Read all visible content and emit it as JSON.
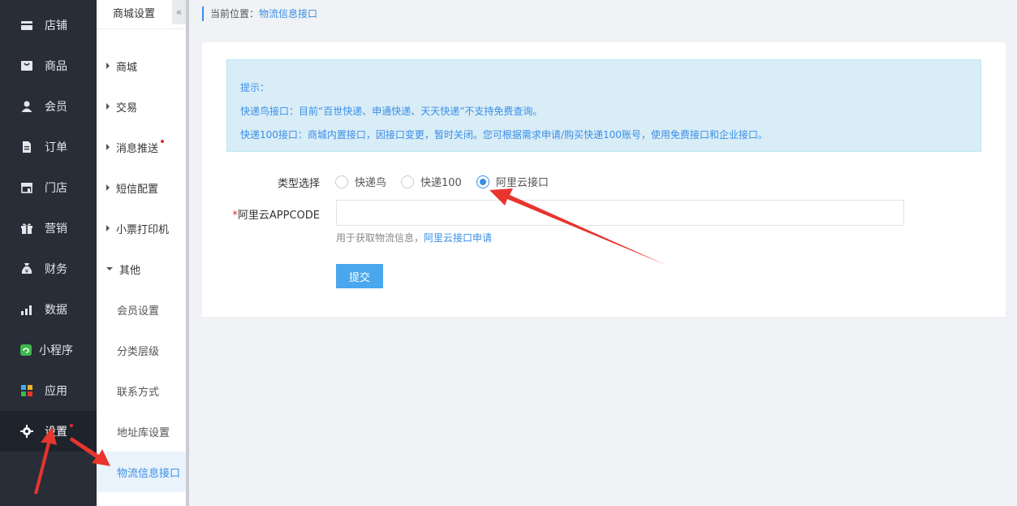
{
  "nav": {
    "items": [
      {
        "label": "店铺",
        "icon": "store-icon"
      },
      {
        "label": "商品",
        "icon": "bag-icon"
      },
      {
        "label": "会员",
        "icon": "user-icon"
      },
      {
        "label": "订单",
        "icon": "document-icon"
      },
      {
        "label": "门店",
        "icon": "shop-icon"
      },
      {
        "label": "营销",
        "icon": "gift-icon"
      },
      {
        "label": "财务",
        "icon": "money-bag-icon"
      },
      {
        "label": "数据",
        "icon": "bar-chart-icon"
      },
      {
        "label": "小程序",
        "icon": "mini-program-icon"
      },
      {
        "label": "应用",
        "icon": "apps-icon"
      },
      {
        "label": "设置",
        "icon": "gear-icon"
      }
    ],
    "active": "设置"
  },
  "submenu": {
    "title": "商城设置",
    "collapse": "«",
    "groups": [
      {
        "label": "商城"
      },
      {
        "label": "交易"
      },
      {
        "label": "消息推送"
      },
      {
        "label": "短信配置"
      },
      {
        "label": "小票打印机"
      },
      {
        "label": "其他"
      }
    ],
    "children": [
      {
        "label": "会员设置"
      },
      {
        "label": "分类层级"
      },
      {
        "label": "联系方式"
      },
      {
        "label": "地址库设置"
      },
      {
        "label": "物流信息接口"
      }
    ]
  },
  "breadcrumb": {
    "prefix": "当前位置：",
    "current": "物流信息接口"
  },
  "tip": {
    "title": "提示：",
    "line1": "快递鸟接口：目前“百世快递、申通快递、天天快递”不支持免费查询。",
    "line2": "快递100接口：商城内置接口，因接口变更，暂时关闭。您可根据需求申请/购买快递100账号，使用免费接口和企业接口。"
  },
  "form": {
    "type_label": "类型选择",
    "options": [
      "快递鸟",
      "快递100",
      "阿里云接口"
    ],
    "selected": "阿里云接口",
    "appcode_required": "*",
    "appcode_label": "阿里云APPCODE",
    "appcode_value": "",
    "help_text": "用于获取物流信息，",
    "help_link": "阿里云接口申请",
    "submit_label": "提交"
  },
  "colors": {
    "nav_bg": "#282d38",
    "accent": "#3a8ee6",
    "submit_bg": "#4aa7ee",
    "tip_bg": "#d9edf7",
    "arrow": "#e8352e"
  }
}
